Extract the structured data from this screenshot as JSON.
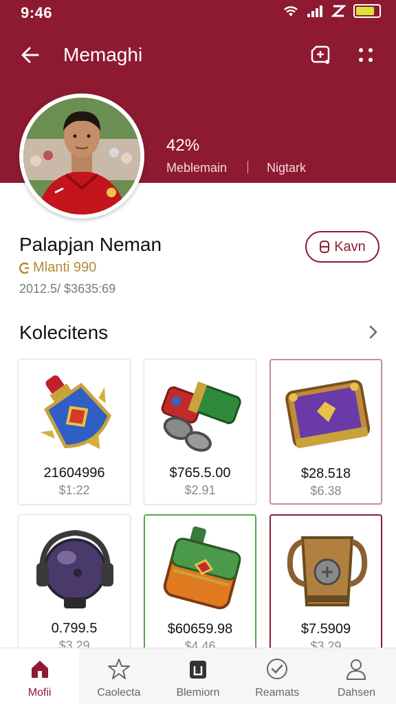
{
  "status_bar": {
    "time": "9:46"
  },
  "toolbar": {
    "title": "Memaghi"
  },
  "profile": {
    "stat_value": "42%",
    "stat_label_1": "Meblemain",
    "stat_label_2": "Nigtark",
    "name": "Palapjan Neman",
    "subtitle": "Mlanti 990",
    "meta": "2012.5/ $3635:69",
    "follow_label": "Kavn"
  },
  "collections": {
    "title": "Kolecitens",
    "items": [
      {
        "price": "21604996",
        "sub": "$1:22"
      },
      {
        "price": "$765.5.00",
        "sub": "$2.91"
      },
      {
        "price": "$28.518",
        "sub": "$6.38"
      },
      {
        "price": "0.799.5",
        "sub": "$3.29"
      },
      {
        "price": "$60659.98",
        "sub": "$4.46"
      },
      {
        "price": "$7.5909",
        "sub": "$3.29"
      }
    ]
  },
  "bottom_nav": [
    {
      "label": "Mofii",
      "icon": "home-icon"
    },
    {
      "label": "Caolecta",
      "icon": "star-icon"
    },
    {
      "label": "Blemiorn",
      "icon": "bag-icon"
    },
    {
      "label": "Reamats",
      "icon": "check-circle-icon"
    },
    {
      "label": "Dahsen",
      "icon": "user-icon"
    }
  ],
  "colors": {
    "brand": "#8e1a32",
    "accent_gold": "#b38a35",
    "battery": "#d9e33a"
  },
  "battery_level": 0.8
}
